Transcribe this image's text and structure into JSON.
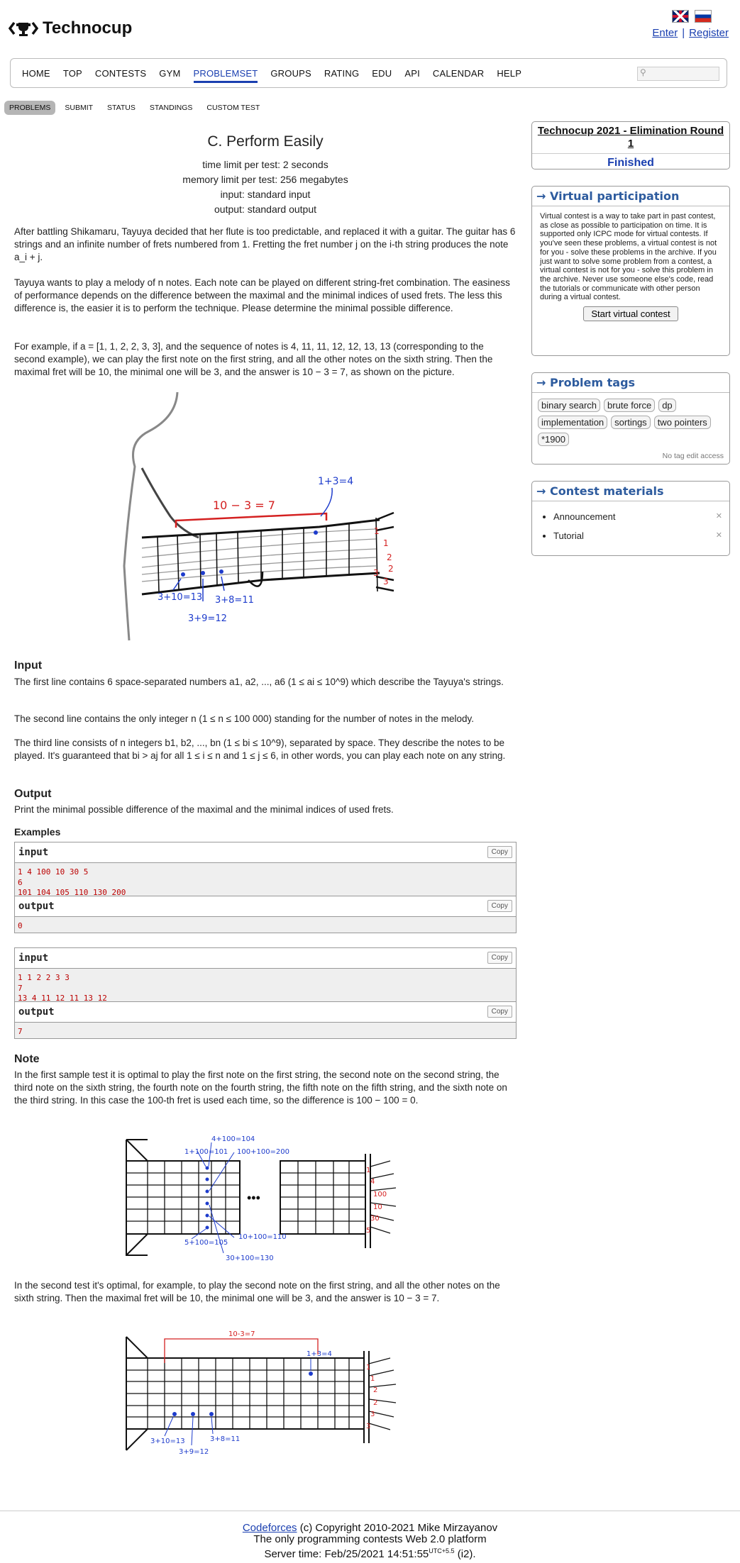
{
  "header": {
    "logo_text": "Technocup",
    "enter": "Enter",
    "register": "Register",
    "auth_sep": "|"
  },
  "menu": [
    "HOME",
    "TOP",
    "CONTESTS",
    "GYM",
    "PROBLEMSET",
    "GROUPS",
    "RATING",
    "EDU",
    "API",
    "CALENDAR",
    "HELP"
  ],
  "menu_active": "PROBLEMSET",
  "subnav": [
    "PROBLEMS",
    "SUBMIT",
    "STATUS",
    "STANDINGS",
    "CUSTOM TEST"
  ],
  "problem": {
    "title": "C. Perform Easily",
    "time_limit": "time limit per test: 2 seconds",
    "memory_limit": "memory limit per test: 256 megabytes",
    "input": "input: standard input",
    "output": "output: standard output",
    "legend_p1": "After battling Shikamaru, Tayuya decided that her flute is too predictable, and replaced it with a guitar. The guitar has 6 strings and an infinite number of frets numbered from 1. Fretting the fret number j on the i-th string produces the note a_i + j.",
    "legend_p2": "Tayuya wants to play a melody of n notes. Each note can be played on different string-fret combination. The easiness of performance depends on the difference between the maximal and the minimal indices of used frets. The less this difference is, the easier it is to perform the technique. Please determine the minimal possible difference.",
    "legend_p3": "For example, if a = [1, 1, 2, 2, 3, 3], and the sequence of notes is 4, 11, 11, 12, 12, 13, 13 (corresponding to the second example), we can play the first note on the first string, and all the other notes on the sixth string. Then the maximal fret will be 10, the minimal one will be 3, and the answer is 10 − 3 = 7, as shown on the picture.",
    "sketch_labels": {
      "top": "10 − 3 = 7",
      "one_plus_three": "1+3=4",
      "a": "3+10=13",
      "b": "3+9=12",
      "c": "3+8=11",
      "s1": "1",
      "s2": "1",
      "s3": "2",
      "s4": "2",
      "s5": "3",
      "s6": "3"
    },
    "input_title": "Input",
    "input_p1": "The first line contains 6 space-separated numbers a1, a2, ..., a6 (1 ≤ ai ≤ 10^9) which describe the Tayuya's strings.",
    "input_p2": "The second line contains the only integer n (1 ≤ n ≤ 100 000) standing for the number of notes in the melody.",
    "input_p3": "The third line consists of n integers b1, b2, ..., bn (1 ≤ bi ≤ 10^9), separated by space. They describe the notes to be played. It's guaranteed that bi > aj for all 1 ≤ i ≤ n and 1 ≤ j ≤ 6, in other words, you can play each note on any string.",
    "output_title": "Output",
    "output_p": "Print the minimal possible difference of the maximal and the minimal indices of used frets.",
    "examples_title": "Examples",
    "input_label": "input",
    "output_label": "output",
    "copy_label": "Copy",
    "examples": [
      {
        "input": "1 4 100 10 30 5\n6\n101 104 105 110 130 200",
        "output": "0"
      },
      {
        "input": "1 1 2 2 3 3\n7\n13 4 11 12 11 13 12",
        "output": "7"
      }
    ],
    "note_title": "Note",
    "note_p1": "In the first sample test it is optimal to play the first note on the first string, the second note on the second string, the third note on the sixth string, the fourth note on the fourth string, the fifth note on the fifth string, and the sixth note on the third string. In this case the 100-th fret is used each time, so the difference is 100 − 100 = 0.",
    "fig1_labels": {
      "a": "4+100=104",
      "b": "1+100=101",
      "c": "100+100=200",
      "d": "5+100=105",
      "e": "10+100=110",
      "f": "30+100=130",
      "dots": "•••",
      "s1": "1",
      "s2": "4",
      "s3": "100",
      "s4": "10",
      "s5": "30",
      "s6": "5"
    },
    "note_p2": "In the second test it's optimal, for example, to play the second note on the first string, and all the other notes on the sixth string. Then the maximal fret will be 10, the minimal one will be 3, and the answer is 10 − 3 = 7.",
    "fig2_labels": {
      "top": "10-3=7",
      "one": "1+3=4",
      "a": "3+10=13",
      "b": "3+9=12",
      "c": "3+8=11",
      "s1": "1",
      "s2": "1",
      "s3": "2",
      "s4": "2",
      "s5": "3",
      "s6": "3"
    }
  },
  "sidebar": {
    "contest_name": "Technocup 2021 - Elimination Round 1",
    "contest_status": "Finished",
    "vp_title": "→ Virtual participation",
    "vp_text": "Virtual contest is a way to take part in past contest, as close as possible to participation on time. It is supported only ICPC mode for virtual contests. If you've seen these problems, a virtual contest is not for you - solve these problems in the archive. If you just want to solve some problem from a contest, a virtual contest is not for you - solve this problem in the archive. Never use someone else's code, read the tutorials or communicate with other person during a virtual contest.",
    "vp_button": "Start virtual contest",
    "tags_title": "→ Problem tags",
    "tags": [
      "binary search",
      "brute force",
      "dp",
      "implementation",
      "sortings",
      "two pointers",
      "*1900"
    ],
    "no_edit": "No tag edit access",
    "materials_title": "→ Contest materials",
    "materials": [
      "Announcement",
      "Tutorial"
    ],
    "x_mark": "✕"
  },
  "footer": {
    "link": "Codeforces",
    "copyright": " (c) Copyright 2010-2021 Mike Mirzayanov",
    "platform": "The only programming contests Web 2.0 platform",
    "server_time_label": "Server time: Feb/25/2021 14:51:55",
    "tz": "UTC+5.5",
    "tail": " (i2)."
  },
  "colors": {
    "accent": "#1a3fb0",
    "sidebar_title": "#2d5b9e",
    "sample_text": "#bb0000",
    "sketch_blue": "#1e3ccc",
    "sketch_red": "#d42020"
  }
}
